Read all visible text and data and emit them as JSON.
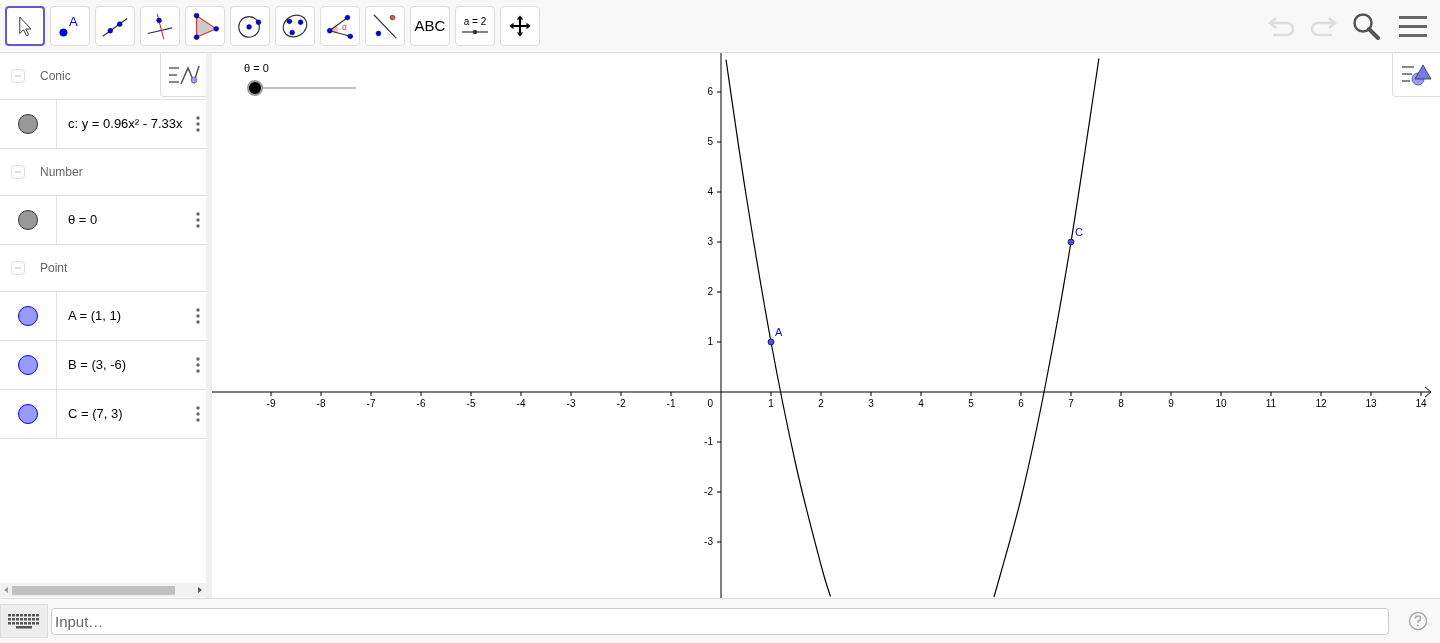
{
  "toolbar": {
    "tools": [
      {
        "kind": "move",
        "selected": true
      },
      {
        "kind": "point",
        "label": "A",
        "selected": false
      },
      {
        "kind": "line",
        "selected": false
      },
      {
        "kind": "perpendicular",
        "selected": false
      },
      {
        "kind": "polygon",
        "selected": false
      },
      {
        "kind": "circle",
        "selected": false
      },
      {
        "kind": "conic",
        "selected": false
      },
      {
        "kind": "angle",
        "label": "α",
        "selected": false
      },
      {
        "kind": "reflect",
        "selected": false
      },
      {
        "kind": "text",
        "label": "ABC",
        "selected": false
      },
      {
        "kind": "slider",
        "label": "a = 2",
        "selected": false
      },
      {
        "kind": "pan",
        "selected": false
      }
    ],
    "undo_disabled": true,
    "redo_disabled": true
  },
  "algebra": {
    "groups": [
      {
        "header": "Conic",
        "expanded": true,
        "items": [
          {
            "text": "c: y = 0.96x² - 7.33x",
            "color": "#999999"
          }
        ]
      },
      {
        "header": "Number",
        "expanded": true,
        "items": [
          {
            "text": "θ = 0",
            "color": "#999999"
          }
        ]
      },
      {
        "header": "Point",
        "expanded": true,
        "items": [
          {
            "text": "A = (1, 1)",
            "color": "#9999ff"
          },
          {
            "text": "B = (3, -6)",
            "color": "#9999ff"
          },
          {
            "text": "C = (7, 3)",
            "color": "#9999ff"
          }
        ]
      }
    ]
  },
  "graphics": {
    "slider": {
      "label": "θ = 0",
      "level": 0
    },
    "origin_label": "0",
    "chart_data": {
      "type": "line",
      "xlim": [
        -10.18,
        14.24
      ],
      "ylim": [
        -4.12,
        6.78
      ],
      "xticks": [
        -9,
        -8,
        -7,
        -6,
        -5,
        -4,
        -3,
        -2,
        -1,
        1,
        2,
        3,
        4,
        5,
        6,
        7,
        8,
        9,
        10,
        11,
        12,
        13,
        14
      ],
      "yticks": [
        6,
        5,
        4,
        3,
        2,
        1,
        -1,
        -2,
        -3
      ],
      "x": [
        0.1,
        0.5,
        1,
        1.5,
        2,
        2.19,
        3.8,
        5.46,
        6,
        6.5,
        7,
        7.5,
        7.55
      ],
      "series": [
        {
          "color": "#000000",
          "values": [
            6.65,
            3.95,
            1,
            -1.47,
            -3.46,
            -4.09,
            null,
            -4.1,
            -2.13,
            0.2,
            3,
            6.28,
            6.63
          ]
        }
      ]
    },
    "points": [
      {
        "label": "A"
      },
      {
        "label": "C"
      }
    ]
  },
  "input_bar": {
    "placeholder": "Input…"
  }
}
